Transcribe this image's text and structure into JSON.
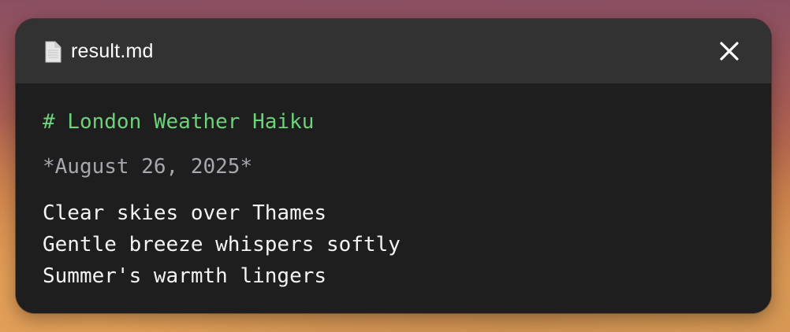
{
  "window": {
    "filename": "result.md",
    "file_icon": "document-icon",
    "close_icon": "close-icon"
  },
  "document": {
    "heading": "# London Weather Haiku",
    "date": "*August 26, 2025*",
    "lines": [
      "Clear skies over Thames",
      "Gentle breeze whispers softly",
      "Summer's warmth lingers"
    ]
  },
  "colors": {
    "heading": "#6ed27a",
    "date": "#a7a7ad",
    "body_text": "#f4f4f4",
    "window_bg": "#1e1e1e",
    "titlebar_bg": "#323232"
  }
}
